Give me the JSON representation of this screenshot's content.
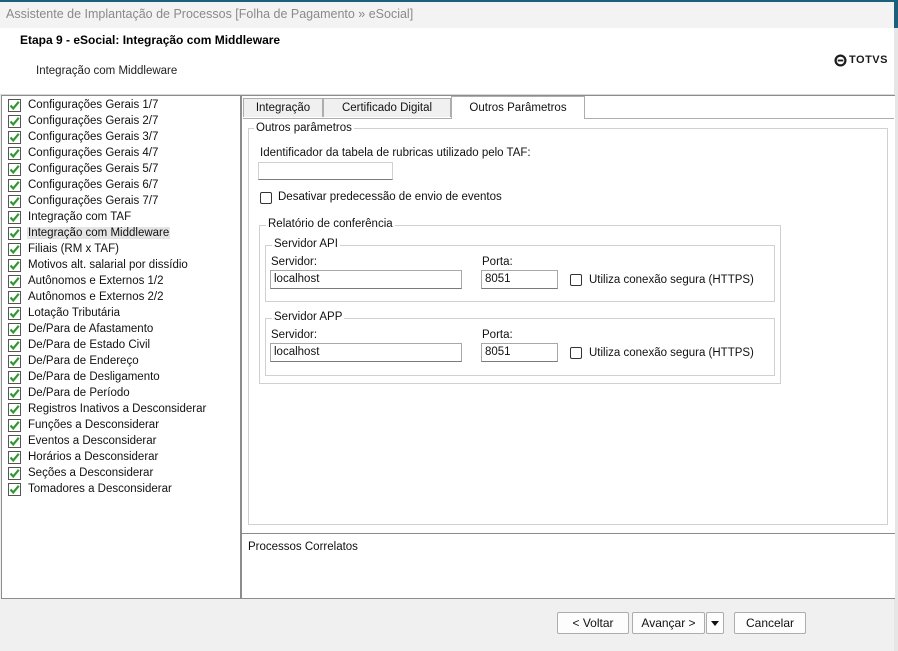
{
  "window": {
    "title": "Assistente de Implantação de Processos [Folha de Pagamento » eSocial]"
  },
  "header": {
    "step_title": "Etapa 9 - eSocial: Integração com Middleware",
    "step_subtitle": "Integração com Middleware",
    "logo_text": "TOTVS"
  },
  "sidebar": {
    "items": [
      {
        "label": "Configurações Gerais 1/7"
      },
      {
        "label": "Configurações Gerais 2/7"
      },
      {
        "label": "Configurações Gerais 3/7"
      },
      {
        "label": "Configurações Gerais 4/7"
      },
      {
        "label": "Configurações Gerais 5/7"
      },
      {
        "label": "Configurações Gerais 6/7"
      },
      {
        "label": "Configurações Gerais 7/7"
      },
      {
        "label": "Integração com TAF"
      },
      {
        "label": "Integração com Middleware",
        "selected": true
      },
      {
        "label": "Filiais (RM x TAF)"
      },
      {
        "label": "Motivos alt. salarial por dissídio"
      },
      {
        "label": "Autônomos e Externos 1/2"
      },
      {
        "label": "Autônomos e Externos 2/2"
      },
      {
        "label": "Lotação Tributária"
      },
      {
        "label": "De/Para de Afastamento"
      },
      {
        "label": "De/Para de Estado Civil"
      },
      {
        "label": "De/Para de Endereço"
      },
      {
        "label": "De/Para de Desligamento"
      },
      {
        "label": "De/Para de Período"
      },
      {
        "label": "Registros Inativos a Desconsiderar"
      },
      {
        "label": "Funções a Desconsiderar"
      },
      {
        "label": "Eventos a Desconsiderar"
      },
      {
        "label": "Horários a Desconsiderar"
      },
      {
        "label": "Seções a Desconsiderar"
      },
      {
        "label": "Tomadores a Desconsiderar"
      }
    ]
  },
  "tabs": [
    {
      "label": "Integração"
    },
    {
      "label": "Certificado Digital"
    },
    {
      "label": "Outros Parâmetros",
      "active": true
    }
  ],
  "outros": {
    "group_label": "Outros parâmetros",
    "rubricas_label": "Identificador da tabela de rubricas utilizado pelo TAF:",
    "rubricas_value": "",
    "desativar_label": "Desativar predecessão de envio de eventos",
    "relatorio_label": "Relatório de conferência",
    "api": {
      "group_label": "Servidor API",
      "servidor_label": "Servidor:",
      "servidor_value": "localhost",
      "porta_label": "Porta:",
      "porta_value": "8051",
      "https_label": "Utiliza conexão segura (HTTPS)"
    },
    "app": {
      "group_label": "Servidor APP",
      "servidor_label": "Servidor:",
      "servidor_value": "localhost",
      "porta_label": "Porta:",
      "porta_value": "8051",
      "https_label": "Utiliza conexão segura (HTTPS)"
    }
  },
  "correlatos": {
    "label": "Processos Correlatos"
  },
  "footer": {
    "back_label": "< Voltar",
    "next_label": "Avançar >",
    "cancel_label": "Cancelar"
  },
  "colors": {
    "check_green": "#2e9a2e",
    "title_gray": "#8a8a8a",
    "accent": "#1c5f7a"
  }
}
